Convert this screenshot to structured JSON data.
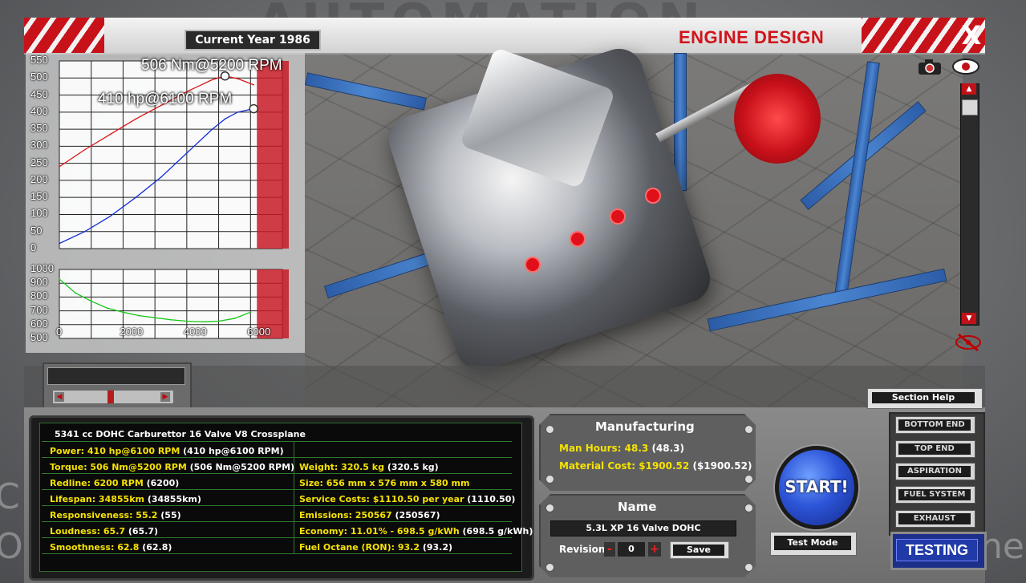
{
  "header": {
    "year": "Current Year 1986",
    "title": "ENGINE DESIGN",
    "close": "X"
  },
  "graph": {
    "top_axis": [
      "550",
      "500",
      "450",
      "400",
      "350",
      "300",
      "250",
      "200",
      "150",
      "100",
      "50",
      "0"
    ],
    "bottom_axis": [
      "1000",
      "900",
      "800",
      "700",
      "600",
      "500"
    ],
    "x_axis": [
      "0",
      "2000",
      "4000",
      "6000"
    ],
    "torque_peak": "506 Nm@5200 RPM",
    "power_peak": "410 hp@6100 RPM"
  },
  "chart_data": [
    {
      "type": "line",
      "ylim": [
        0,
        550
      ],
      "xlim": [
        0,
        7000
      ],
      "series": [
        {
          "color": "#d81414",
          "x": [
            0,
            800,
            1600,
            2400,
            3200,
            4000,
            4800,
            5200,
            5600,
            6100
          ],
          "values": [
            240,
            290,
            335,
            380,
            420,
            460,
            495,
            506,
            498,
            480
          ]
        },
        {
          "color": "#1430d8",
          "x": [
            0,
            800,
            1600,
            2400,
            3200,
            4000,
            4800,
            5200,
            5600,
            6100
          ],
          "values": [
            15,
            50,
            95,
            150,
            210,
            280,
            350,
            380,
            400,
            410
          ]
        }
      ],
      "redline": 6200
    },
    {
      "type": "line",
      "ylim": [
        500,
        1000
      ],
      "xlim": [
        0,
        7000
      ],
      "series": [
        {
          "color": "#16c816",
          "x": [
            0,
            500,
            1000,
            1500,
            2000,
            2500,
            3000,
            3500,
            4000,
            4500,
            5000,
            5500,
            6000
          ],
          "values": [
            930,
            830,
            770,
            720,
            690,
            665,
            650,
            635,
            625,
            620,
            625,
            645,
            690
          ]
        }
      ],
      "redline": 6200
    }
  ],
  "stats": {
    "title": "5341 cc DOHC Carburettor 16 Valve V8 Crossplane",
    "left": [
      {
        "key": "Power:",
        "val": "410 hp@6100 RPM",
        "sub": "(410 hp@6100 RPM)"
      },
      {
        "key": "Torque:",
        "val": "506 Nm@5200 RPM",
        "sub": "(506 Nm@5200 RPM)"
      },
      {
        "key": "Redline:",
        "val": "6200 RPM",
        "sub": "(6200)"
      },
      {
        "key": "Lifespan:",
        "val": "34855km",
        "sub": "(34855km)"
      },
      {
        "key": "Responsiveness:",
        "val": "55.2",
        "sub": "(55)"
      },
      {
        "key": "Loudness:",
        "val": "65.7",
        "sub": "(65.7)"
      },
      {
        "key": "Smoothness:",
        "val": "62.8",
        "sub": "(62.8)"
      }
    ],
    "right": [
      {
        "key": "Weight:",
        "val": "320.5 kg",
        "sub": "(320.5 kg)"
      },
      {
        "key": "Size:",
        "val": "656 mm x 576 mm x 580 mm",
        "sub": ""
      },
      {
        "key": "Service Costs:",
        "val": "$1110.50 per year",
        "sub": "(1110.50)"
      },
      {
        "key": "Emissions:",
        "val": "250567",
        "sub": "(250567)"
      },
      {
        "key": "Economy:",
        "val": "11.01% - 698.5 g/kWh",
        "sub": "(698.5 g/kWh)"
      },
      {
        "key": "Fuel Octane (RON):",
        "val": "93.2",
        "sub": "(93.2)"
      }
    ]
  },
  "manufacturing": {
    "title": "Manufacturing",
    "man_hours_key": "Man Hours:",
    "man_hours_val": "48.3",
    "man_hours_sub": "(48.3)",
    "material_key": "Material Cost:",
    "material_val": "$1900.52",
    "material_sub": "($1900.52)"
  },
  "name_panel": {
    "title": "Name",
    "name": "5.3L XP 16 Valve DOHC",
    "revision_label": "Revision",
    "minus": "-",
    "revision": "0",
    "plus": "+",
    "save": "Save"
  },
  "actions": {
    "start": "START!",
    "test_mode": "Test Mode",
    "section_help": "Section Help",
    "testing": "TESTING"
  },
  "nav": [
    "BOTTOM END",
    "TOP END",
    "ASPIRATION",
    "FUEL SYSTEM",
    "EXHAUST"
  ],
  "view_controls": {
    "camera_icon": "camera-icon",
    "eye_icon": "eye-icon"
  }
}
